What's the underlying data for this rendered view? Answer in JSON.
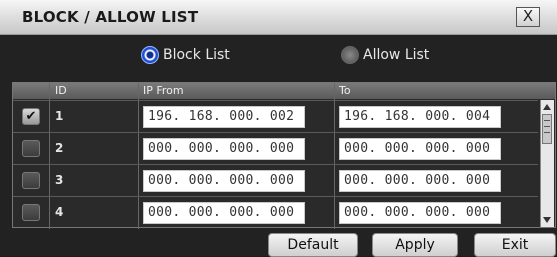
{
  "title": "BLOCK / ALLOW LIST",
  "close_label": "X",
  "mode": {
    "block_label": "Block List",
    "allow_label": "Allow List",
    "selected": "Block List"
  },
  "table": {
    "headers": [
      "ID",
      "IP From",
      "To"
    ],
    "rows": [
      {
        "checked": true,
        "check_mark": "✔",
        "id": "1",
        "ip_from": "196. 168. 000. 002",
        "ip_to": "196. 168. 000. 004"
      },
      {
        "checked": false,
        "check_mark": "",
        "id": "2",
        "ip_from": "000. 000. 000. 000",
        "ip_to": "000. 000. 000. 000"
      },
      {
        "checked": false,
        "check_mark": "",
        "id": "3",
        "ip_from": "000. 000. 000. 000",
        "ip_to": "000. 000. 000. 000"
      },
      {
        "checked": false,
        "check_mark": "",
        "id": "4",
        "ip_from": "000. 000. 000. 000",
        "ip_to": "000. 000. 000. 000"
      }
    ]
  },
  "buttons": {
    "default": "Default",
    "apply": "Apply",
    "exit": "Exit"
  }
}
